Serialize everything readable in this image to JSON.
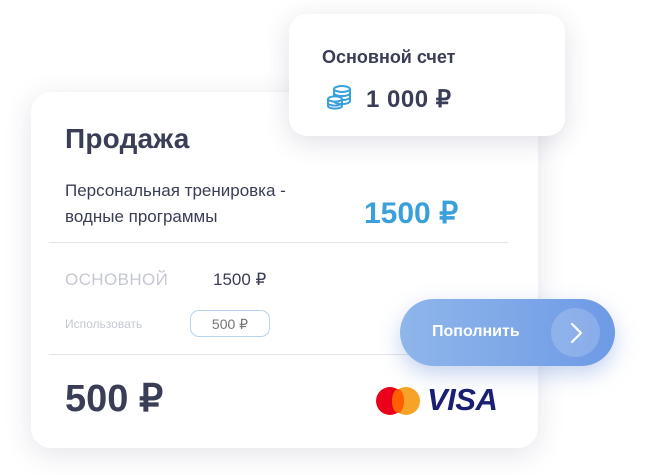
{
  "sale": {
    "title": "Продажа",
    "description": "Персональная тренировка - водные программы",
    "price": "1500 ₽",
    "account_label": "ОСНОВНОЙ",
    "account_value": "1500 ₽",
    "use_label": "Использовать",
    "use_input_placeholder": "500 ₽",
    "total": "500 ₽",
    "payment_logos": [
      "mastercard-logo",
      "visa-logo"
    ],
    "visa_text": "VISA"
  },
  "balance": {
    "label": "Основной счет",
    "value": "1 000 ₽",
    "icon": "coins-icon"
  },
  "topup": {
    "label": "Пополнить",
    "icon": "chevron-right-icon"
  },
  "colors": {
    "accent_blue": "#3aa0dc",
    "button_gradient_start": "#8fb6ea",
    "button_gradient_end": "#6e9ae6",
    "text_dark": "#3a3d56",
    "text_muted": "#c5c8d3"
  }
}
